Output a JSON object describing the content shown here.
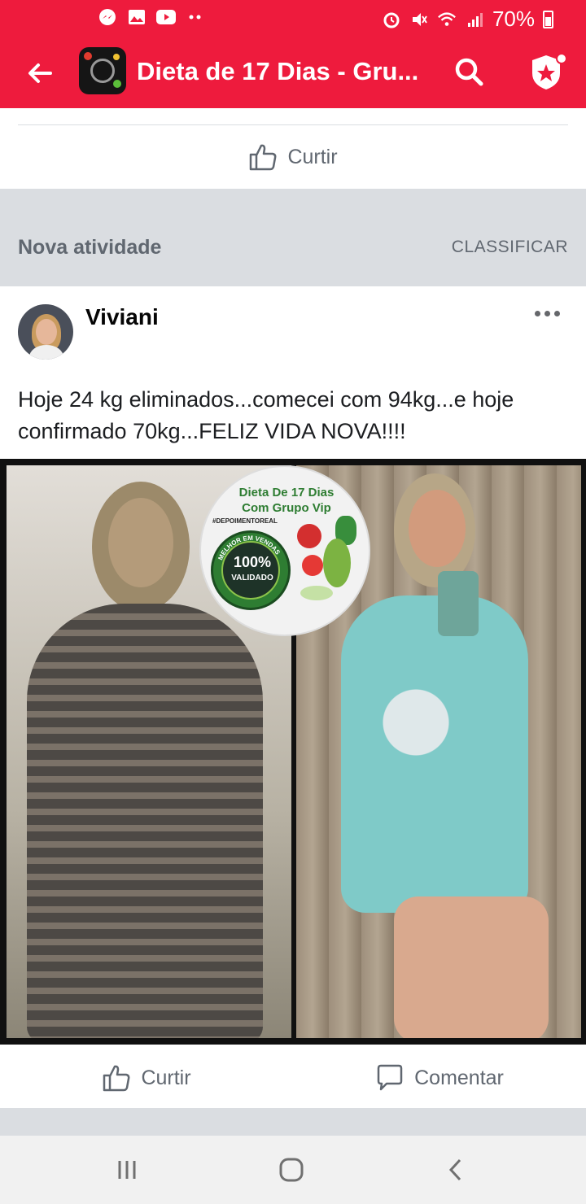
{
  "status_bar": {
    "battery": "70%",
    "icons": [
      "messenger-icon",
      "gallery-icon",
      "youtube-icon",
      "more-dots-icon",
      "alarm-icon",
      "mute-icon",
      "wifi-icon",
      "signal-icon",
      "battery-icon"
    ]
  },
  "app_bar": {
    "title": "Dieta de 17 Dias - Gru...",
    "icons": [
      "back-arrow-icon",
      "group-avatar-icon",
      "search-icon",
      "shield-badge-icon"
    ]
  },
  "top_like": {
    "label": "Curtir"
  },
  "section": {
    "title": "Nova atividade",
    "sort_label": "CLASSIFICAR"
  },
  "post": {
    "author": "Viviani",
    "text": "Hoje 24 kg eliminados...comecei com 94kg...e hoje confirmado 70kg...FELIZ VIDA NOVA!!!!",
    "badge": {
      "title_line1": "Dieta De 17 Dias",
      "title_line2": "Com Grupo Vip",
      "tag": "#DEPOIMENTOREAL",
      "seal_percent": "100%",
      "seal_text": "VALIDADO",
      "seal_ring_text": "MELHOR EM VENDAS"
    },
    "actions": {
      "like_label": "Curtir",
      "comment_label": "Comentar"
    }
  },
  "colors": {
    "app_bar": "#ee1b3d",
    "secondary_text": "#606770",
    "divider": "#dadde1"
  }
}
